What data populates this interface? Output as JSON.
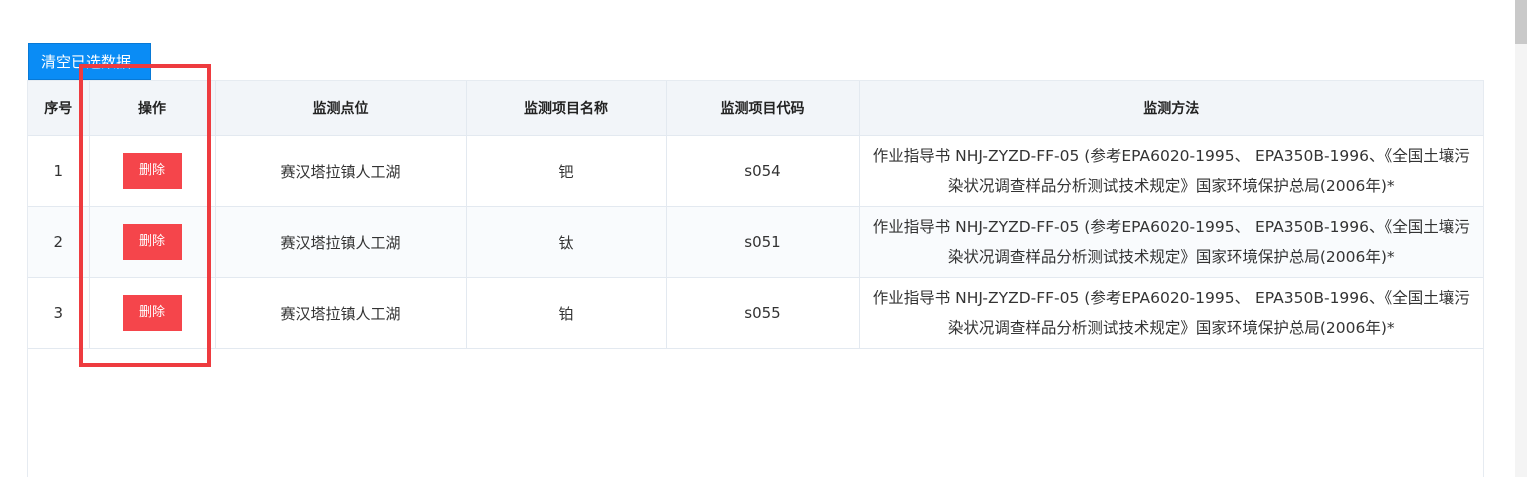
{
  "toolbar": {
    "clear_label": "清空已选数据"
  },
  "table": {
    "headers": {
      "index": "序号",
      "action": "操作",
      "point": "监测点位",
      "item_name": "监测项目名称",
      "item_code": "监测项目代码",
      "method": "监测方法"
    },
    "rows": [
      {
        "index": "1",
        "action": "删除",
        "point": "赛汉塔拉镇人工湖",
        "item_name": "钯",
        "item_code": "s054",
        "method": "作业指导书 NHJ-ZYZD-FF-05 (参考EPA6020-1995、 EPA350B-1996、《全国土壤污染状况调查样品分析测试技术规定》国家环境保护总局(2006年)*"
      },
      {
        "index": "2",
        "action": "删除",
        "point": "赛汉塔拉镇人工湖",
        "item_name": "钛",
        "item_code": "s051",
        "method": "作业指导书 NHJ-ZYZD-FF-05 (参考EPA6020-1995、 EPA350B-1996、《全国土壤污染状况调查样品分析测试技术规定》国家环境保护总局(2006年)*"
      },
      {
        "index": "3",
        "action": "删除",
        "point": "赛汉塔拉镇人工湖",
        "item_name": "铂",
        "item_code": "s055",
        "method": "作业指导书 NHJ-ZYZD-FF-05 (参考EPA6020-1995、 EPA350B-1996、《全国土壤污染状况调查样品分析测试技术规定》国家环境保护总局(2006年)*"
      }
    ]
  },
  "colors": {
    "primary_button": "#0a8cf5",
    "delete_button": "#f5454b",
    "highlight_border": "#ee3b3f",
    "header_background": "#f2f5f9"
  }
}
